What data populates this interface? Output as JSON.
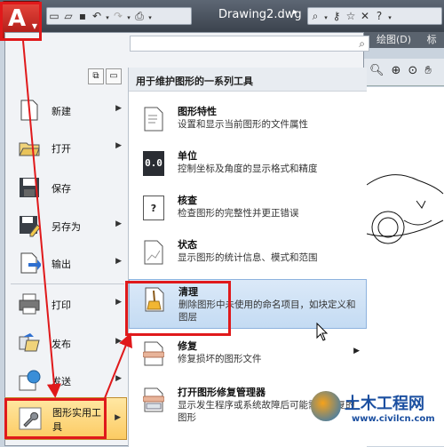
{
  "titlebar": {
    "app_letter": "A",
    "doc_title": "Drawing2.dwg",
    "quick_access_icons": [
      "new-icon",
      "open-icon",
      "save-icon",
      "undo-icon",
      "redo-icon",
      "plot-icon"
    ],
    "help_icons": [
      "binoculars-icon",
      "key-icon",
      "star-icon",
      "help-icon"
    ]
  },
  "ribbon": {
    "tab_draw": "绘图(D)",
    "tab_partial": "标"
  },
  "menu": {
    "search_placeholder": "",
    "items": [
      {
        "label": "新建",
        "icon": "new-document-icon",
        "has_arrow": true
      },
      {
        "label": "打开",
        "icon": "open-folder-icon",
        "has_arrow": true
      },
      {
        "label": "保存",
        "icon": "save-disk-icon",
        "has_arrow": false
      },
      {
        "label": "另存为",
        "icon": "save-as-icon",
        "has_arrow": true
      },
      {
        "label": "输出",
        "icon": "export-icon",
        "has_arrow": true
      },
      {
        "label": "打印",
        "icon": "printer-icon",
        "has_arrow": true
      },
      {
        "label": "发布",
        "icon": "publish-icon",
        "has_arrow": true
      },
      {
        "label": "发送",
        "icon": "send-globe-icon",
        "has_arrow": true
      },
      {
        "label": "图形实用工具",
        "icon": "wrench-icon",
        "has_arrow": true
      }
    ]
  },
  "submenu": {
    "header": "用于维护图形的一系列工具",
    "items": [
      {
        "title": "图形特性",
        "desc": "设置和显示当前图形的文件属性"
      },
      {
        "title": "单位",
        "desc": "控制坐标及角度的显示格式和精度",
        "icon_text": "0.0"
      },
      {
        "title": "核查",
        "desc": "检查图形的完整性并更正错误",
        "icon_text": "?"
      },
      {
        "title": "状态",
        "desc": "显示图形的统计信息、模式和范围"
      },
      {
        "title": "清理",
        "desc": "删除图形中未使用的命名项目，如块定义和图层"
      },
      {
        "title": "修复",
        "desc": "修复损坏的图形文件"
      },
      {
        "title": "打开图形修复管理器",
        "desc": "显示发生程序或系统故障后可能需要修复的图形"
      }
    ]
  },
  "watermark": {
    "text": "土木工程网",
    "url": "www.civilcn.com"
  },
  "colors": {
    "highlight_red": "#e0191b",
    "hover_blue": "#c4dbf3",
    "active_orange": "#fccb63"
  }
}
